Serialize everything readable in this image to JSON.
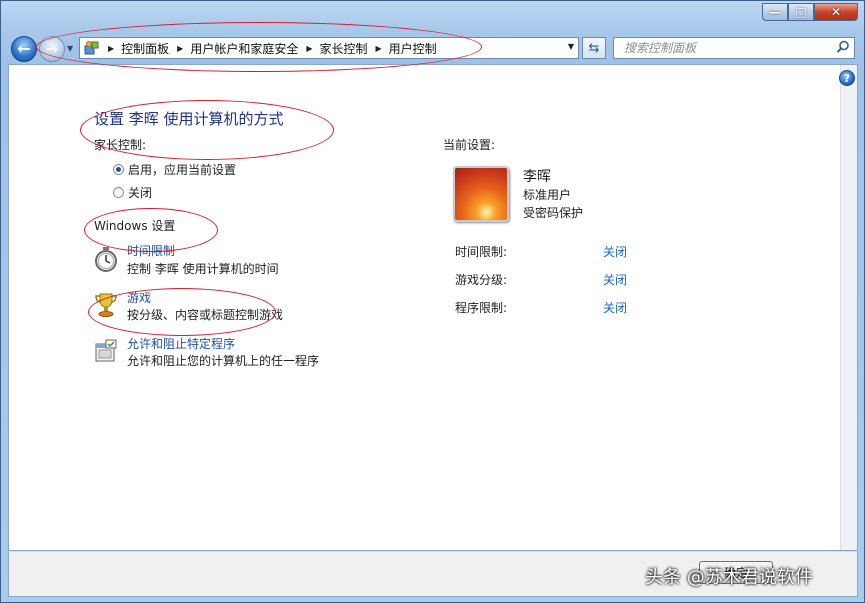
{
  "window": {
    "caption_min": "—",
    "caption_max": "□",
    "caption_close": "✕"
  },
  "nav": {
    "breadcrumb": [
      "控制面板",
      "用户帐户和家庭安全",
      "家长控制",
      "用户控制"
    ],
    "search_placeholder": "搜索控制面板"
  },
  "main": {
    "title": "设置 李晖 使用计算机的方式",
    "parental_control_label": "家长控制:",
    "option_on": "启用，应用当前设置",
    "option_off": "关闭",
    "windows_settings_label": "Windows 设置",
    "items": [
      {
        "title": "时间限制",
        "desc": "控制 李晖 使用计算机的时间",
        "icon": "stopwatch-icon"
      },
      {
        "title": "游戏",
        "desc": "按分级、内容或标题控制游戏",
        "icon": "game-trophy-icon"
      },
      {
        "title": "允许和阻止特定程序",
        "desc": "允许和阻止您的计算机上的任一程序",
        "icon": "program-window-icon"
      }
    ]
  },
  "current": {
    "label": "当前设置:",
    "user_name": "李晖",
    "user_type": "标准用户",
    "user_password": "受密码保护",
    "rows": [
      {
        "label": "时间限制:",
        "value": "关闭"
      },
      {
        "label": "游戏分级:",
        "value": "关闭"
      },
      {
        "label": "程序限制:",
        "value": "关闭"
      }
    ]
  },
  "footer": {
    "ok_button": "确定"
  },
  "watermark": "头条 @苏木君说软件",
  "colors": {
    "title_blue": "#1e3287",
    "link_blue": "#1a67c9",
    "annotation_red": "#e0192a"
  }
}
